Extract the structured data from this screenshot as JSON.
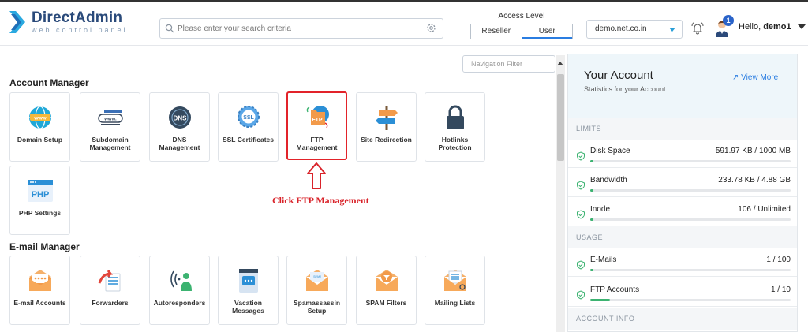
{
  "header": {
    "brand": "DirectAdmin",
    "brand_sub": "web control panel",
    "search_placeholder": "Please enter your search criteria",
    "access_label": "Access Level",
    "access_options": [
      "Reseller",
      "User"
    ],
    "access_active": "User",
    "domain": "demo.net.co.in",
    "notifications": "1",
    "greeting": "Hello,",
    "username": "demo1"
  },
  "nav_filter_placeholder": "Navigation Filter",
  "sections": {
    "account_manager": {
      "title": "Account Manager",
      "tiles": [
        {
          "label": "Domain Setup",
          "icon": "globe-icon"
        },
        {
          "label": "Subdomain Management",
          "icon": "www-bar-icon"
        },
        {
          "label": "DNS Management",
          "icon": "dns-icon"
        },
        {
          "label": "SSL Certificates",
          "icon": "ssl-badge-icon"
        },
        {
          "label": "FTP Management",
          "icon": "ftp-folder-icon"
        },
        {
          "label": "Site Redirection",
          "icon": "signpost-icon"
        },
        {
          "label": "Hotlinks Protection",
          "icon": "padlock-icon"
        },
        {
          "label": "PHP Settings",
          "icon": "php-icon"
        }
      ]
    },
    "email_manager": {
      "title": "E-mail Manager",
      "tiles": [
        {
          "label": "E-mail Accounts",
          "icon": "envelope-icon"
        },
        {
          "label": "Forwarders",
          "icon": "forward-icon"
        },
        {
          "label": "Autoresponders",
          "icon": "autoresponder-icon"
        },
        {
          "label": "Vacation Messages",
          "icon": "vacation-icon"
        },
        {
          "label": "Spamassassin Setup",
          "icon": "spam-envelope-icon"
        },
        {
          "label": "SPAM Filters",
          "icon": "filter-envelope-icon"
        },
        {
          "label": "Mailing Lists",
          "icon": "list-envelope-icon"
        }
      ]
    }
  },
  "annotation": {
    "text": "Click FTP Management"
  },
  "account_panel": {
    "title": "Your Account",
    "subtitle": "Statistics for your Account",
    "view_more": "View More",
    "limits_label": "LIMITS",
    "usage_label": "USAGE",
    "info_label": "ACCOUNT INFO",
    "limits": [
      {
        "name": "Disk Space",
        "value": "591.97 KB / 1000 MB",
        "fraction": 0.006
      },
      {
        "name": "Bandwidth",
        "value": "233.78 KB / 4.88 GB",
        "fraction": 0.005
      },
      {
        "name": "Inode",
        "value": "106 / Unlimited",
        "fraction": 0.005
      }
    ],
    "usage": [
      {
        "name": "E-Mails",
        "value": "1 / 100",
        "fraction": 0.01
      },
      {
        "name": "FTP Accounts",
        "value": "1 / 10",
        "fraction": 0.1
      }
    ]
  },
  "colors": {
    "accent": "#2a7de1",
    "highlight": "#e2232a",
    "progress": "#3cb371",
    "brand": "#2a4a7a"
  }
}
